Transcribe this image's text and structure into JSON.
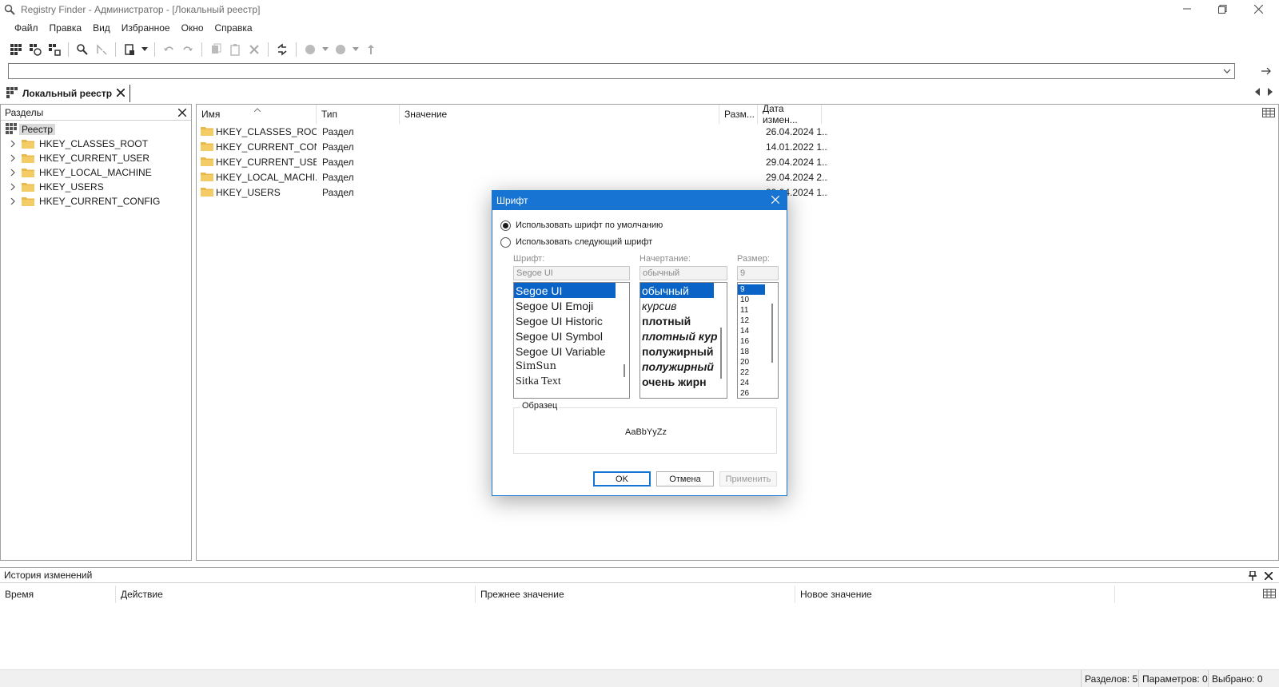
{
  "window": {
    "title": "Registry Finder - Администратор - [Локальный реестр]"
  },
  "menu": [
    "Файл",
    "Правка",
    "Вид",
    "Избранное",
    "Окно",
    "Справка"
  ],
  "document_tab": {
    "label": "Локальный реестр"
  },
  "left_pane": {
    "title": "Разделы",
    "root": "Реестр",
    "items": [
      "HKEY_CLASSES_ROOT",
      "HKEY_CURRENT_USER",
      "HKEY_LOCAL_MACHINE",
      "HKEY_USERS",
      "HKEY_CURRENT_CONFIG"
    ]
  },
  "list": {
    "columns": [
      "Имя",
      "Тип",
      "Значение",
      "Разм...",
      "Дата измен..."
    ],
    "rows": [
      {
        "name": "HKEY_CLASSES_ROOT",
        "type": "Раздел",
        "date": "26.04.2024 1..."
      },
      {
        "name": "HKEY_CURRENT_CON...",
        "type": "Раздел",
        "date": "14.01.2022 1..."
      },
      {
        "name": "HKEY_CURRENT_USER",
        "type": "Раздел",
        "date": "29.04.2024 1..."
      },
      {
        "name": "HKEY_LOCAL_MACHI...",
        "type": "Раздел",
        "date": "29.04.2024 2..."
      },
      {
        "name": "HKEY_USERS",
        "type": "Раздел",
        "date": "29.04.2024 1..."
      }
    ]
  },
  "history": {
    "title": "История изменений",
    "columns": [
      "Время",
      "Действие",
      "Прежнее значение",
      "Новое значение"
    ]
  },
  "status": {
    "sections": "Разделов: 5",
    "params": "Параметров: 0",
    "selected": "Выбрано: 0"
  },
  "font_dialog": {
    "title": "Шрифт",
    "radio_default": "Использовать шрифт по умолчанию",
    "radio_custom": "Использовать следующий шрифт",
    "font_label": "Шрифт:",
    "style_label": "Начертание:",
    "size_label": "Размер:",
    "font_value": "Segoe UI",
    "style_value": "обычный",
    "size_value": "9",
    "fonts": [
      "Segoe UI",
      "Segoe UI Emoji",
      "Segoe UI Historic",
      "Segoe UI Symbol",
      "Segoe UI Variable",
      "SimSun",
      "Sitka Text"
    ],
    "styles": [
      "обычный",
      "курсив",
      "плотный",
      "плотный кур",
      "полужирный",
      "полужирный",
      "очень жирн"
    ],
    "sizes": [
      "9",
      "10",
      "11",
      "12",
      "14",
      "16",
      "18",
      "20",
      "22",
      "24",
      "26"
    ],
    "sample_label": "Образец",
    "sample_text": "AaBbYyZz",
    "ok": "OK",
    "cancel": "Отмена",
    "apply": "Применить"
  },
  "colors": {
    "dialog_title_bg": "#1774d2",
    "selection": "#0a64c8",
    "folder": "#e8b84a"
  }
}
